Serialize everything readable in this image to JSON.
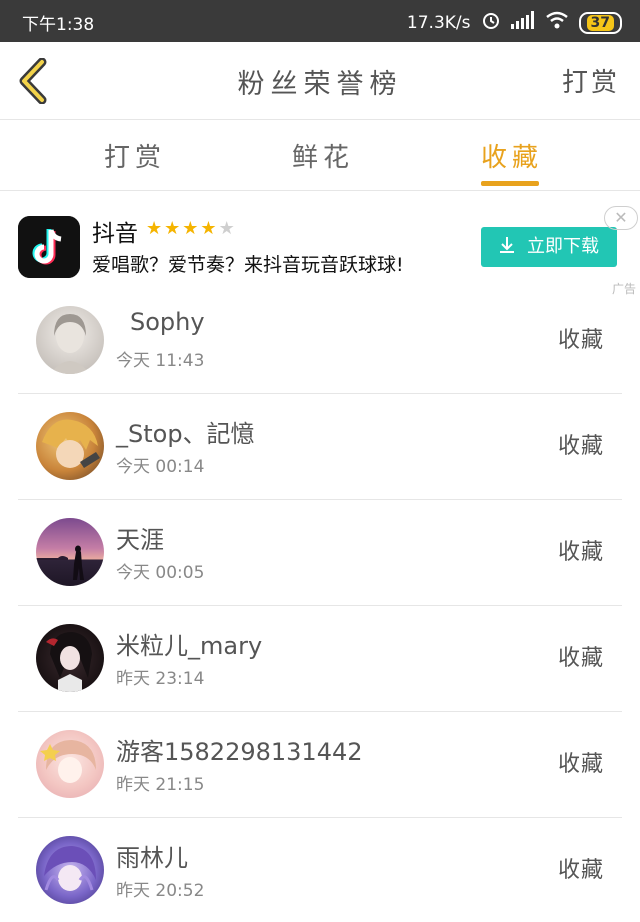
{
  "status_bar": {
    "time": "下午1:38",
    "speed": "17.3K/s",
    "battery": "37"
  },
  "nav": {
    "title": "粉丝荣誉榜",
    "action": "打赏"
  },
  "tabs": [
    {
      "label": "打赏",
      "active": false
    },
    {
      "label": "鲜花",
      "active": false
    },
    {
      "label": "收藏",
      "active": true
    }
  ],
  "ad": {
    "app_name": "抖音",
    "rating": 4,
    "rating_max": 5,
    "description": "爱唱歌？爱节奏？来抖音玩音跃球球!",
    "button_label": "立即下载",
    "close_label": "✕",
    "ad_tag": "广告"
  },
  "fans": [
    {
      "name": "Sophy",
      "time": "今天 11:43",
      "action": "收藏"
    },
    {
      "name": "_Stop、記憶",
      "time": "今天 00:14",
      "action": "收藏"
    },
    {
      "name": "天涯",
      "time": "今天 00:05",
      "action": "收藏"
    },
    {
      "name": "米粒儿_mary",
      "time": "昨天 23:14",
      "action": "收藏"
    },
    {
      "name": "游客1582298131442",
      "time": "昨天 21:15",
      "action": "收藏"
    },
    {
      "name": "雨林儿",
      "time": "昨天 20:52",
      "action": "收藏"
    }
  ],
  "colors": {
    "accent": "#e8a21d",
    "download": "#22c6b4",
    "status_bar": "#3a3a3a"
  }
}
